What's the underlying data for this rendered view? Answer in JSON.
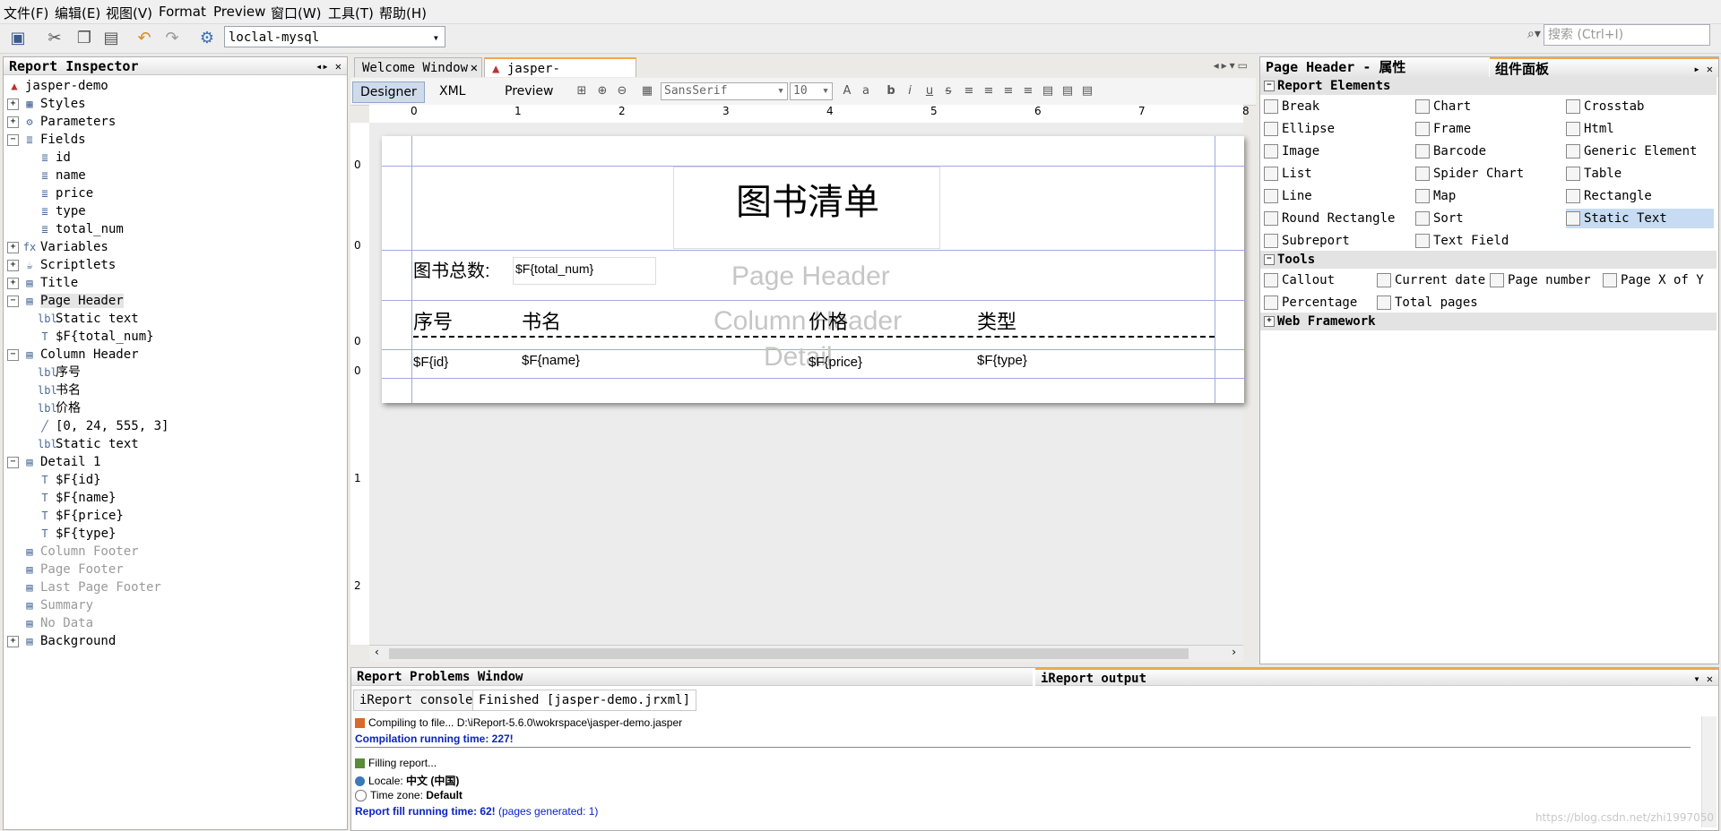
{
  "menu": [
    "文件(F)",
    "编辑(E)",
    "视图(V)",
    "Format",
    "Preview",
    "窗口(W)",
    "工具(T)",
    "帮助(H)"
  ],
  "toolbar": {
    "datasource": "loclal-mysql",
    "search_placeholder": "搜索 (Ctrl+I)",
    "icons": [
      "save-icon",
      "cut-icon",
      "copy-icon",
      "paste-icon",
      "undo-icon",
      "redo-icon",
      "datasource-icon"
    ]
  },
  "inspector": {
    "title": "Report Inspector",
    "root": "jasper-demo",
    "nodes": [
      {
        "label": "Styles",
        "level": 1,
        "icon": "styles",
        "expand": "+"
      },
      {
        "label": "Parameters",
        "level": 1,
        "icon": "params",
        "expand": "+"
      },
      {
        "label": "Fields",
        "level": 1,
        "icon": "db",
        "expand": "-"
      },
      {
        "label": "id",
        "level": 2,
        "icon": "db"
      },
      {
        "label": "name",
        "level": 2,
        "icon": "db"
      },
      {
        "label": "price",
        "level": 2,
        "icon": "db"
      },
      {
        "label": "type",
        "level": 2,
        "icon": "db"
      },
      {
        "label": "total_num",
        "level": 2,
        "icon": "db"
      },
      {
        "label": "Variables",
        "level": 1,
        "icon": "fx",
        "expand": "+"
      },
      {
        "label": "Scriptlets",
        "level": 1,
        "icon": "cup",
        "expand": "+"
      },
      {
        "label": "Title",
        "level": 1,
        "icon": "band",
        "expand": "+"
      },
      {
        "label": "Page Header",
        "level": 1,
        "icon": "band",
        "expand": "-",
        "selected": true
      },
      {
        "label": "Static text",
        "level": 2,
        "icon": "label"
      },
      {
        "label": "$F{total_num}",
        "level": 2,
        "icon": "T"
      },
      {
        "label": "Column Header",
        "level": 1,
        "icon": "band",
        "expand": "-"
      },
      {
        "label": "序号",
        "level": 2,
        "icon": "label"
      },
      {
        "label": "书名",
        "level": 2,
        "icon": "label"
      },
      {
        "label": "价格",
        "level": 2,
        "icon": "label"
      },
      {
        "label": "[0, 24, 555, 3]",
        "level": 2,
        "icon": "line"
      },
      {
        "label": "Static text",
        "level": 2,
        "icon": "label"
      },
      {
        "label": "Detail 1",
        "level": 1,
        "icon": "band",
        "expand": "-"
      },
      {
        "label": "$F{id}",
        "level": 2,
        "icon": "T"
      },
      {
        "label": "$F{name}",
        "level": 2,
        "icon": "T"
      },
      {
        "label": "$F{price}",
        "level": 2,
        "icon": "T"
      },
      {
        "label": "$F{type}",
        "level": 2,
        "icon": "T"
      },
      {
        "label": "Column Footer",
        "level": 1,
        "icon": "band",
        "dim": true
      },
      {
        "label": "Page Footer",
        "level": 1,
        "icon": "band",
        "dim": true
      },
      {
        "label": "Last Page Footer",
        "level": 1,
        "icon": "band",
        "dim": true
      },
      {
        "label": "Summary",
        "level": 1,
        "icon": "band",
        "dim": true
      },
      {
        "label": "No Data",
        "level": 1,
        "icon": "band",
        "dim": true
      },
      {
        "label": "Background",
        "level": 1,
        "icon": "band",
        "expand": "+"
      }
    ]
  },
  "editor": {
    "tabs": [
      "Welcome Window",
      "jasper-demo.jrxml"
    ],
    "views": [
      "Designer",
      "XML",
      "Preview"
    ],
    "font": "SansSerif",
    "font_size": "10",
    "ruler_top": [
      "0",
      "1",
      "2",
      "3",
      "4",
      "5",
      "6",
      "7",
      "8"
    ],
    "ruler_left": [
      "0",
      "0",
      "0",
      "0",
      "1",
      "2"
    ],
    "report": {
      "title": "图书清单",
      "total_label": "图书总数:",
      "total_field": "$F{total_num}",
      "band_page_header": "Page Header",
      "band_column_header": "Column Header",
      "band_detail": "Detail",
      "col_headers": [
        "序号",
        "书名",
        "价格",
        "类型"
      ],
      "detail_fields": [
        "$F{id}",
        "$F{name}",
        "$F{price}",
        "$F{type}"
      ]
    }
  },
  "palette": {
    "props_title": "Page Header - 属性",
    "title": "组件面板",
    "sections": {
      "report_elements": "Report Elements",
      "tools": "Tools",
      "web": "Web Framework"
    },
    "report_elements": [
      "Break",
      "Chart",
      "Crosstab",
      "Ellipse",
      "Frame",
      "Html",
      "Image",
      "Barcode",
      "Generic Element",
      "List",
      "Spider Chart",
      "Table",
      "Line",
      "Map",
      "Rectangle",
      "Round Rectangle",
      "Sort",
      "Static Text",
      "Subreport",
      "Text Field"
    ],
    "tools": [
      "Callout",
      "Current date",
      "Page number",
      "Page X of Y",
      "Percentage",
      "Total pages"
    ]
  },
  "bottom": {
    "problems_title": "Report Problems Window",
    "output_title": "iReport output",
    "tabs": [
      "iReport console",
      "Finished [jasper-demo.jrxml]"
    ],
    "log": {
      "compiling": "Compiling to file... D:\\iReport-5.6.0\\wokrspace\\jasper-demo.jasper",
      "compile_time": "Compilation running time: 227!",
      "filling": "Filling report...",
      "locale_label": "Locale: ",
      "locale_value": "中文 (中国)",
      "tz_label": "Time zone: ",
      "tz_value": "Default",
      "fill_time": "Report fill running time: 62!",
      "pages": "(pages generated: 1)"
    }
  },
  "watermark": "https://blog.csdn.net/zhi1997050"
}
